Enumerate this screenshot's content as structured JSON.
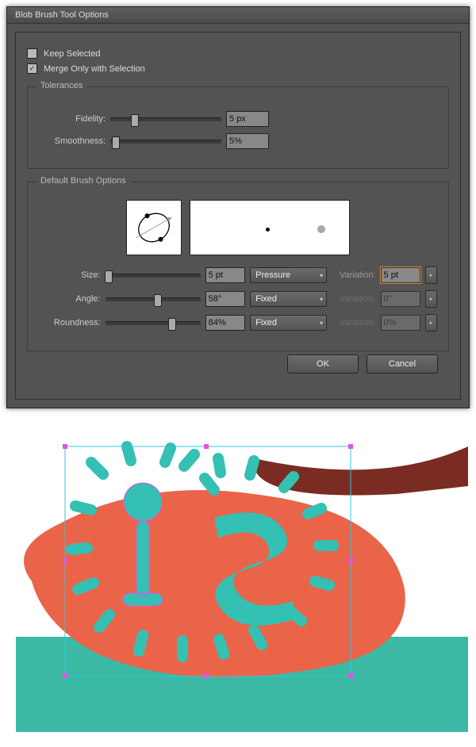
{
  "dialog": {
    "title": "Blob Brush Tool Options",
    "keep_selected": {
      "label": "Keep Selected",
      "checked": false
    },
    "merge_only": {
      "label": "Merge Only with Selection",
      "checked": true
    },
    "tolerances": {
      "legend": "Tolerances",
      "fidelity": {
        "label": "Fidelity:",
        "value": "5 px",
        "pos": 22
      },
      "smoothness": {
        "label": "Smoothness:",
        "value": "5%",
        "pos": 5
      }
    },
    "defaults": {
      "legend": "Default Brush Options",
      "size": {
        "label": "Size:",
        "value": "5 pt",
        "pos": 4,
        "control": "Pressure",
        "var_label": "Variation:",
        "var_value": "5 pt",
        "var_enabled": true
      },
      "angle": {
        "label": "Angle:",
        "value": "58°",
        "pos": 55,
        "control": "Fixed",
        "var_label": "Variation:",
        "var_value": "0°",
        "var_enabled": false
      },
      "roundness": {
        "label": "Roundness:",
        "value": "84%",
        "pos": 70,
        "control": "Fixed",
        "var_label": "Variation:",
        "var_value": "0%",
        "var_enabled": false
      }
    },
    "buttons": {
      "ok": "OK",
      "cancel": "Cancel"
    }
  }
}
